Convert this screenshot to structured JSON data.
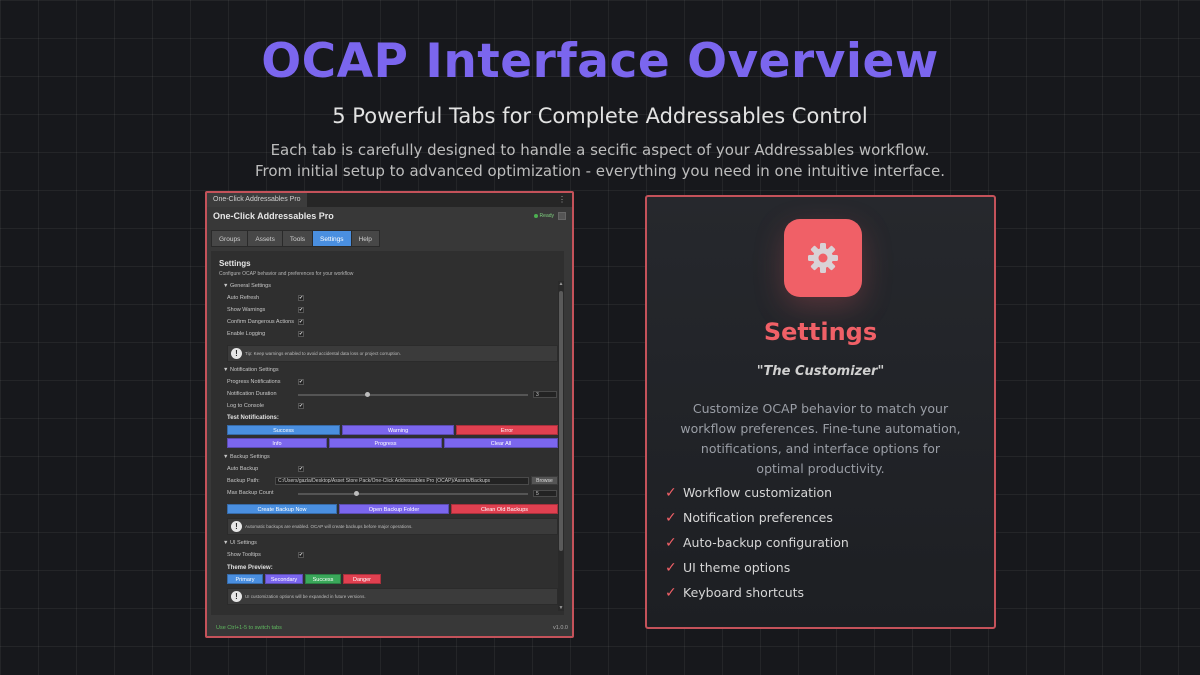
{
  "hero": {
    "title": "OCAP Interface Overview",
    "subtitle": "5 Powerful Tabs for Complete Addressables Control",
    "description_line1": "Each tab is carefully designed to handle a secific aspect of your Addressables workflow.",
    "description_line2": "From initial setup to advanced optimization - everything you need in one intuitive interface."
  },
  "editor": {
    "window_tab": "One-Click Addressables Pro",
    "window_menu": "⋮",
    "app_title": "One-Click Addressables Pro",
    "status": "Ready",
    "tabs": [
      "Groups",
      "Assets",
      "Tools",
      "Settings",
      "Help"
    ],
    "active_tab": "Settings",
    "panel_title": "Settings",
    "panel_subtitle": "Configure OCAP behavior and preferences for your workflow",
    "general": {
      "header": "▼ General Settings",
      "rows": [
        "Auto Refresh",
        "Show Warnings",
        "Confirm Dangerous Actions",
        "Enable Logging"
      ],
      "tip": "Tip: Keep warnings enabled to avoid accidental data loss or project corruption."
    },
    "notification": {
      "header": "▼ Notification Settings",
      "progress_label": "Progress Notifications",
      "duration_label": "Notification Duration",
      "duration_value": "3",
      "duration_fraction": 0.3,
      "log_label": "Log to Console",
      "test_label": "Test Notifications:",
      "buttons_row1": [
        "Success",
        "Warning",
        "Error"
      ],
      "buttons_row2": [
        "Info",
        "Progress",
        "Clear All"
      ]
    },
    "backup": {
      "header": "▼ Backup Settings",
      "auto_label": "Auto Backup",
      "path_label": "Backup Path:",
      "path_value": "C:/Users/gazla/Desktop/Asset Store Pack/One-Click Addressables Pro (OCAP)/Assets/Backups",
      "browse_label": "Browse",
      "max_label": "Max Backup Count",
      "max_value": "5",
      "max_fraction": 0.25,
      "buttons": [
        "Create Backup Now",
        "Open Backup Folder",
        "Clean Old Backups"
      ],
      "info": "Automatic backups are enabled. OCAP will create backups before major operations."
    },
    "ui": {
      "header": "▼ UI Settings",
      "tooltips_label": "Show Tooltips",
      "theme_label": "Theme Preview:",
      "theme_buttons": [
        "Primary",
        "Secondary",
        "Success",
        "Danger"
      ],
      "info": "UI customization options will be expanded in future versions."
    },
    "footer_hint": "Use Ctrl+1-5 to switch tabs",
    "version": "v1.0.0",
    "check_glyph": "✔"
  },
  "card": {
    "icon": "gear-icon",
    "title": "Settings",
    "tagline": "\"The Customizer\"",
    "description": "Customize OCAP behavior to match your workflow preferences. Fine-tune automation, notifications, and interface options for optimal productivity.",
    "features": [
      "Workflow customization",
      "Notification preferences",
      "Auto-backup configuration",
      "UI theme options",
      "Keyboard shortcuts"
    ],
    "check_glyph": "✓"
  },
  "colors": {
    "accent_purple": "#7b66ee",
    "accent_red": "#f06067",
    "border": "#c4525a",
    "unity_blue": "#4a8fe0"
  }
}
